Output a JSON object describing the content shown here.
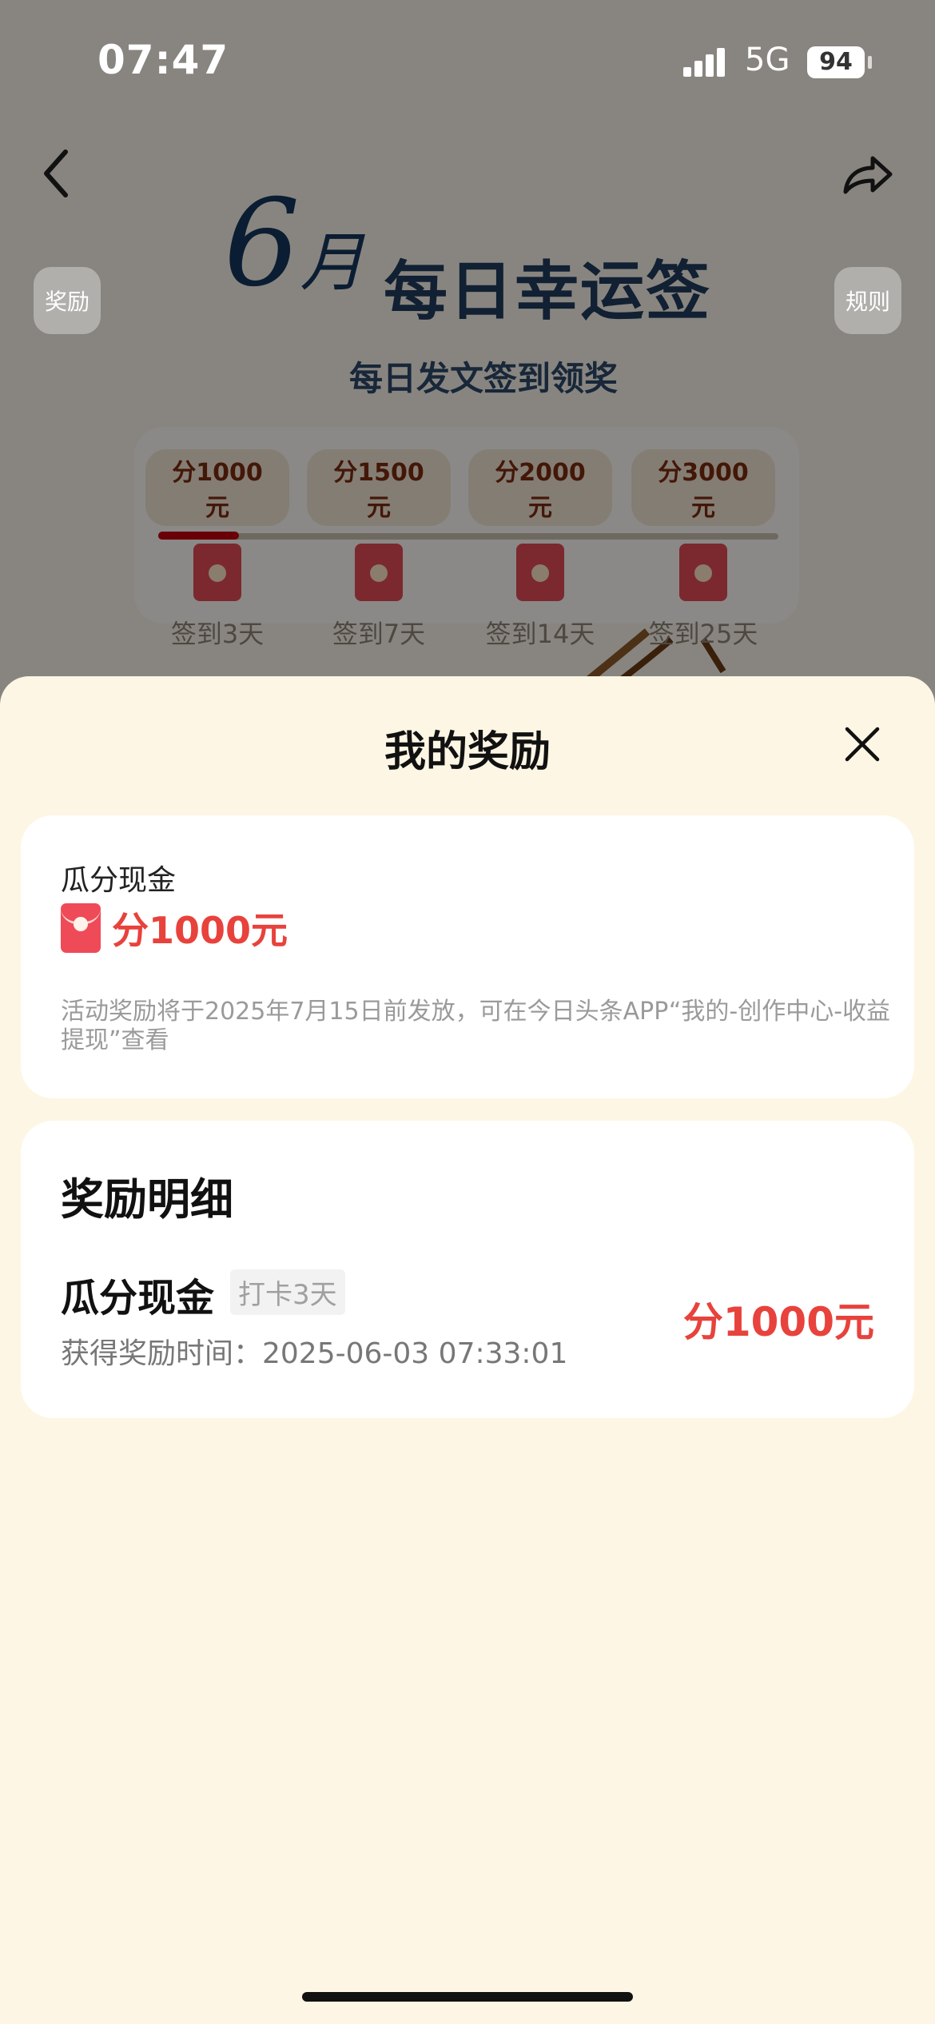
{
  "status_bar": {
    "time": "07:47",
    "network": "5G",
    "battery": "94"
  },
  "background_page": {
    "side_reward_label": "奖励",
    "side_rules_label": "规则",
    "banner_month": "6",
    "banner_month_suffix": "月",
    "banner_title": "每日幸运签",
    "banner_subtitle": "每日发文签到领奖",
    "milestones": [
      {
        "prize": "分1000元",
        "label": "签到3天"
      },
      {
        "prize": "分1500元",
        "label": "签到7天"
      },
      {
        "prize": "分2000元",
        "label": "签到14天"
      },
      {
        "prize": "分3000元",
        "label": "签到25天"
      }
    ],
    "progress_fraction": 0.13
  },
  "sheet": {
    "title": "我的奖励",
    "reward_card": {
      "type": "瓜分现金",
      "amount": "分1000元",
      "note": "活动奖励将于2025年7月15日前发放，可在今日头条APP“我的-创作中心-收益提现”查看"
    },
    "detail_card": {
      "title": "奖励明细",
      "item_name": "瓜分现金",
      "item_tag": "打卡3天",
      "item_time": "获得奖励时间：2025-06-03 07:33:01",
      "item_amount": "分1000元"
    }
  },
  "colors": {
    "accent_red": "#e8423c",
    "sheet_bg": "#fdf6e4",
    "banner_navy": "#15365c"
  },
  "icons": [
    "back-arrow-icon",
    "share-icon",
    "close-icon",
    "red-envelope-icon",
    "signal-icon",
    "battery-icon"
  ]
}
